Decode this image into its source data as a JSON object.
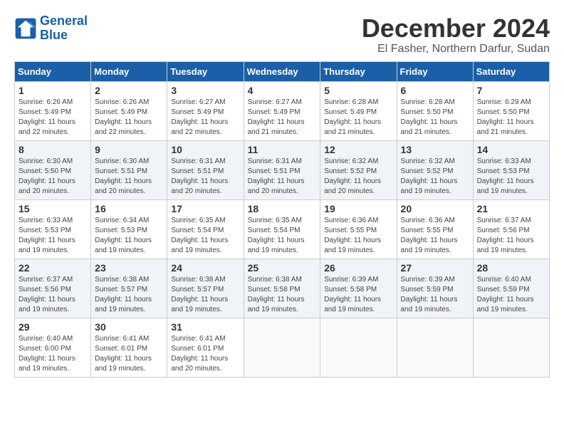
{
  "header": {
    "logo_line1": "General",
    "logo_line2": "Blue",
    "title": "December 2024",
    "subtitle": "El Fasher, Northern Darfur, Sudan"
  },
  "days_of_week": [
    "Sunday",
    "Monday",
    "Tuesday",
    "Wednesday",
    "Thursday",
    "Friday",
    "Saturday"
  ],
  "weeks": [
    [
      {
        "day": "1",
        "info": "Sunrise: 6:26 AM\nSunset: 5:49 PM\nDaylight: 11 hours\nand 22 minutes."
      },
      {
        "day": "2",
        "info": "Sunrise: 6:26 AM\nSunset: 5:49 PM\nDaylight: 11 hours\nand 22 minutes."
      },
      {
        "day": "3",
        "info": "Sunrise: 6:27 AM\nSunset: 5:49 PM\nDaylight: 11 hours\nand 22 minutes."
      },
      {
        "day": "4",
        "info": "Sunrise: 6:27 AM\nSunset: 5:49 PM\nDaylight: 11 hours\nand 21 minutes."
      },
      {
        "day": "5",
        "info": "Sunrise: 6:28 AM\nSunset: 5:49 PM\nDaylight: 11 hours\nand 21 minutes."
      },
      {
        "day": "6",
        "info": "Sunrise: 6:28 AM\nSunset: 5:50 PM\nDaylight: 11 hours\nand 21 minutes."
      },
      {
        "day": "7",
        "info": "Sunrise: 6:29 AM\nSunset: 5:50 PM\nDaylight: 11 hours\nand 21 minutes."
      }
    ],
    [
      {
        "day": "8",
        "info": "Sunrise: 6:30 AM\nSunset: 5:50 PM\nDaylight: 11 hours\nand 20 minutes."
      },
      {
        "day": "9",
        "info": "Sunrise: 6:30 AM\nSunset: 5:51 PM\nDaylight: 11 hours\nand 20 minutes."
      },
      {
        "day": "10",
        "info": "Sunrise: 6:31 AM\nSunset: 5:51 PM\nDaylight: 11 hours\nand 20 minutes."
      },
      {
        "day": "11",
        "info": "Sunrise: 6:31 AM\nSunset: 5:51 PM\nDaylight: 11 hours\nand 20 minutes."
      },
      {
        "day": "12",
        "info": "Sunrise: 6:32 AM\nSunset: 5:52 PM\nDaylight: 11 hours\nand 20 minutes."
      },
      {
        "day": "13",
        "info": "Sunrise: 6:32 AM\nSunset: 5:52 PM\nDaylight: 11 hours\nand 19 minutes."
      },
      {
        "day": "14",
        "info": "Sunrise: 6:33 AM\nSunset: 5:53 PM\nDaylight: 11 hours\nand 19 minutes."
      }
    ],
    [
      {
        "day": "15",
        "info": "Sunrise: 6:33 AM\nSunset: 5:53 PM\nDaylight: 11 hours\nand 19 minutes."
      },
      {
        "day": "16",
        "info": "Sunrise: 6:34 AM\nSunset: 5:53 PM\nDaylight: 11 hours\nand 19 minutes."
      },
      {
        "day": "17",
        "info": "Sunrise: 6:35 AM\nSunset: 5:54 PM\nDaylight: 11 hours\nand 19 minutes."
      },
      {
        "day": "18",
        "info": "Sunrise: 6:35 AM\nSunset: 5:54 PM\nDaylight: 11 hours\nand 19 minutes."
      },
      {
        "day": "19",
        "info": "Sunrise: 6:36 AM\nSunset: 5:55 PM\nDaylight: 11 hours\nand 19 minutes."
      },
      {
        "day": "20",
        "info": "Sunrise: 6:36 AM\nSunset: 5:55 PM\nDaylight: 11 hours\nand 19 minutes."
      },
      {
        "day": "21",
        "info": "Sunrise: 6:37 AM\nSunset: 5:56 PM\nDaylight: 11 hours\nand 19 minutes."
      }
    ],
    [
      {
        "day": "22",
        "info": "Sunrise: 6:37 AM\nSunset: 5:56 PM\nDaylight: 11 hours\nand 19 minutes."
      },
      {
        "day": "23",
        "info": "Sunrise: 6:38 AM\nSunset: 5:57 PM\nDaylight: 11 hours\nand 19 minutes."
      },
      {
        "day": "24",
        "info": "Sunrise: 6:38 AM\nSunset: 5:57 PM\nDaylight: 11 hours\nand 19 minutes."
      },
      {
        "day": "25",
        "info": "Sunrise: 6:38 AM\nSunset: 5:58 PM\nDaylight: 11 hours\nand 19 minutes."
      },
      {
        "day": "26",
        "info": "Sunrise: 6:39 AM\nSunset: 5:58 PM\nDaylight: 11 hours\nand 19 minutes."
      },
      {
        "day": "27",
        "info": "Sunrise: 6:39 AM\nSunset: 5:59 PM\nDaylight: 11 hours\nand 19 minutes."
      },
      {
        "day": "28",
        "info": "Sunrise: 6:40 AM\nSunset: 5:59 PM\nDaylight: 11 hours\nand 19 minutes."
      }
    ],
    [
      {
        "day": "29",
        "info": "Sunrise: 6:40 AM\nSunset: 6:00 PM\nDaylight: 11 hours\nand 19 minutes."
      },
      {
        "day": "30",
        "info": "Sunrise: 6:41 AM\nSunset: 6:01 PM\nDaylight: 11 hours\nand 19 minutes."
      },
      {
        "day": "31",
        "info": "Sunrise: 6:41 AM\nSunset: 6:01 PM\nDaylight: 11 hours\nand 20 minutes."
      },
      {
        "day": "",
        "info": ""
      },
      {
        "day": "",
        "info": ""
      },
      {
        "day": "",
        "info": ""
      },
      {
        "day": "",
        "info": ""
      }
    ]
  ]
}
